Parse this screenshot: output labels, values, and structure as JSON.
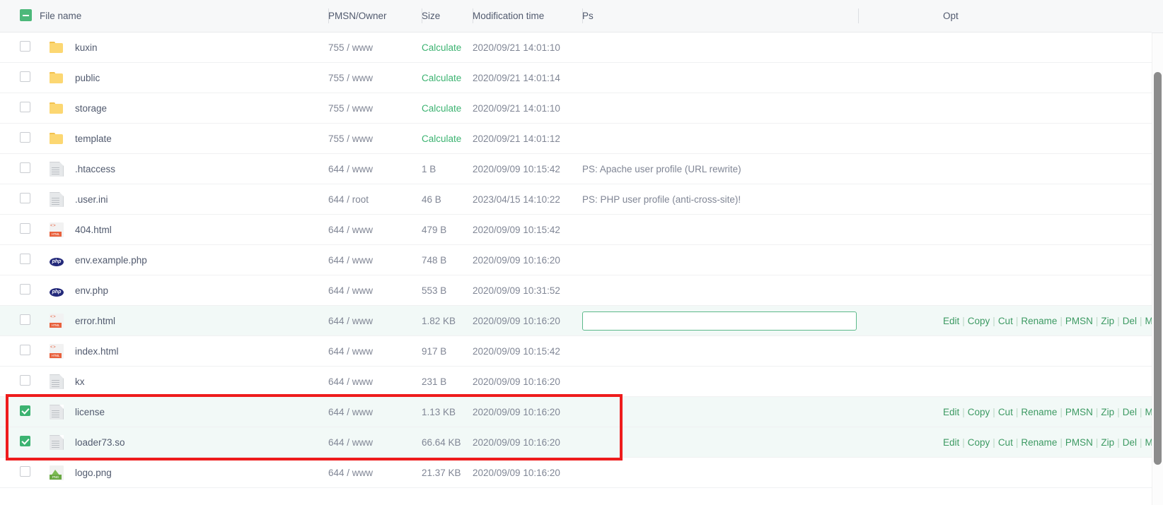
{
  "table": {
    "select_all_state": "indeterminate",
    "columns": [
      {
        "key": "check",
        "label": ""
      },
      {
        "key": "name",
        "label": "File name"
      },
      {
        "key": "owner",
        "label": "PMSN/Owner"
      },
      {
        "key": "size",
        "label": "Size"
      },
      {
        "key": "time",
        "label": "Modification time"
      },
      {
        "key": "ps",
        "label": "Ps"
      },
      {
        "key": "spacer",
        "label": ""
      },
      {
        "key": "opt",
        "label": "Opt"
      }
    ]
  },
  "actions": {
    "labels": [
      "Edit",
      "Copy",
      "Cut",
      "Rename",
      "PMSN",
      "Zip",
      "Del",
      "More"
    ],
    "separator": "|",
    "more_chevron": "∨"
  },
  "rename_input": {
    "value": "",
    "placeholder": ""
  },
  "colors": {
    "accent_green": "#3cb371",
    "link_green": "#3d9a63",
    "selected_row_bg": "#f2f9f7",
    "annotation_red": "#ee1c1c",
    "header_bg": "#f7f8f9"
  },
  "rows": [
    {
      "name": "kuxin",
      "icon": "folder-icon",
      "owner": "755 / www",
      "size": "Calculate",
      "size_is_link": true,
      "time": "2020/09/21 14:01:10",
      "ps": "",
      "checked": false,
      "highlighted": false,
      "show_actions": false,
      "show_input": false
    },
    {
      "name": "public",
      "icon": "folder-icon",
      "owner": "755 / www",
      "size": "Calculate",
      "size_is_link": true,
      "time": "2020/09/21 14:01:14",
      "ps": "",
      "checked": false,
      "highlighted": false,
      "show_actions": false,
      "show_input": false
    },
    {
      "name": "storage",
      "icon": "folder-icon",
      "owner": "755 / www",
      "size": "Calculate",
      "size_is_link": true,
      "time": "2020/09/21 14:01:10",
      "ps": "",
      "checked": false,
      "highlighted": false,
      "show_actions": false,
      "show_input": false
    },
    {
      "name": "template",
      "icon": "folder-icon",
      "owner": "755 / www",
      "size": "Calculate",
      "size_is_link": true,
      "time": "2020/09/21 14:01:12",
      "ps": "",
      "checked": false,
      "highlighted": false,
      "show_actions": false,
      "show_input": false
    },
    {
      "name": ".htaccess",
      "icon": "document-icon",
      "owner": "644 / www",
      "size": "1 B",
      "size_is_link": false,
      "time": "2020/09/09 10:15:42",
      "ps": "PS: Apache user profile (URL rewrite)",
      "checked": false,
      "highlighted": false,
      "show_actions": false,
      "show_input": false
    },
    {
      "name": ".user.ini",
      "icon": "document-icon",
      "owner": "644 / root",
      "size": "46 B",
      "size_is_link": false,
      "time": "2023/04/15 14:10:22",
      "ps": "PS: PHP user profile (anti-cross-site)!",
      "checked": false,
      "highlighted": false,
      "show_actions": false,
      "show_input": false
    },
    {
      "name": "404.html",
      "icon": "html-file-icon",
      "owner": "644 / www",
      "size": "479 B",
      "size_is_link": false,
      "time": "2020/09/09 10:15:42",
      "ps": "",
      "checked": false,
      "highlighted": false,
      "show_actions": false,
      "show_input": false
    },
    {
      "name": "env.example.php",
      "icon": "php-file-icon",
      "owner": "644 / www",
      "size": "748 B",
      "size_is_link": false,
      "time": "2020/09/09 10:16:20",
      "ps": "",
      "checked": false,
      "highlighted": false,
      "show_actions": false,
      "show_input": false
    },
    {
      "name": "env.php",
      "icon": "php-file-icon",
      "owner": "644 / www",
      "size": "553 B",
      "size_is_link": false,
      "time": "2020/09/09 10:31:52",
      "ps": "",
      "checked": false,
      "highlighted": false,
      "show_actions": false,
      "show_input": false
    },
    {
      "name": "error.html",
      "icon": "html-file-icon",
      "owner": "644 / www",
      "size": "1.82 KB",
      "size_is_link": false,
      "time": "2020/09/09 10:16:20",
      "ps": "",
      "checked": false,
      "highlighted": true,
      "show_actions": true,
      "show_input": true
    },
    {
      "name": "index.html",
      "icon": "html-file-icon",
      "owner": "644 / www",
      "size": "917 B",
      "size_is_link": false,
      "time": "2020/09/09 10:15:42",
      "ps": "",
      "checked": false,
      "highlighted": false,
      "show_actions": false,
      "show_input": false
    },
    {
      "name": "kx",
      "icon": "document-icon",
      "owner": "644 / www",
      "size": "231 B",
      "size_is_link": false,
      "time": "2020/09/09 10:16:20",
      "ps": "",
      "checked": false,
      "highlighted": false,
      "show_actions": false,
      "show_input": false
    },
    {
      "name": "license",
      "icon": "document-icon",
      "owner": "644 / www",
      "size": "1.13 KB",
      "size_is_link": false,
      "time": "2020/09/09 10:16:20",
      "ps": "",
      "checked": true,
      "highlighted": true,
      "show_actions": true,
      "show_input": false
    },
    {
      "name": "loader73.so",
      "icon": "document-icon",
      "owner": "644 / www",
      "size": "66.64 KB",
      "size_is_link": false,
      "time": "2020/09/09 10:16:20",
      "ps": "",
      "checked": true,
      "highlighted": true,
      "show_actions": true,
      "show_input": false
    },
    {
      "name": "logo.png",
      "icon": "png-file-icon",
      "owner": "644 / www",
      "size": "21.37 KB",
      "size_is_link": false,
      "time": "2020/09/09 10:16:20",
      "ps": "",
      "checked": false,
      "highlighted": false,
      "show_actions": false,
      "show_input": false
    }
  ]
}
